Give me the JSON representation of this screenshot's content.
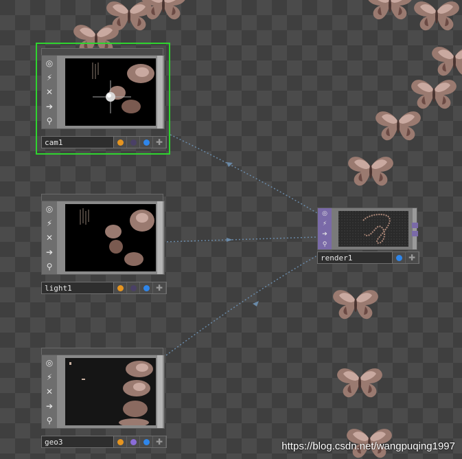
{
  "colors": {
    "selection": "#2fd42f",
    "link": "#6a8aa8",
    "flag_orange": "#e69520",
    "flag_purple_dim": "#4a4066",
    "flag_purple": "#8a6cd8",
    "flag_blue": "#2f86ea",
    "render_accent": "#7a6aa8"
  },
  "nodes": {
    "cam1": {
      "name": "cam1",
      "icons": [
        "viewer-icon",
        "graph-icon",
        "close-icon",
        "arrow-right-icon",
        "pin-icon"
      ],
      "flags": [
        "orange",
        "purple-dim",
        "blue",
        "plus"
      ]
    },
    "light1": {
      "name": "light1",
      "icons": [
        "viewer-icon",
        "graph-icon",
        "close-icon",
        "arrow-right-icon",
        "pin-icon"
      ],
      "flags": [
        "orange",
        "purple-dim",
        "blue",
        "plus"
      ]
    },
    "geo3": {
      "name": "geo3",
      "icons": [
        "viewer-icon",
        "graph-icon",
        "close-icon",
        "arrow-right-icon",
        "pin-icon"
      ],
      "flags": [
        "orange",
        "purple",
        "blue",
        "plus"
      ]
    },
    "render1": {
      "name": "render1",
      "icons": [
        "viewer-icon",
        "graph-icon",
        "arrow-right-icon",
        "pin-icon"
      ],
      "flags": [
        "blue",
        "plus"
      ]
    }
  },
  "watermark": "https://blog.csdn.net/wangpuqing1997"
}
